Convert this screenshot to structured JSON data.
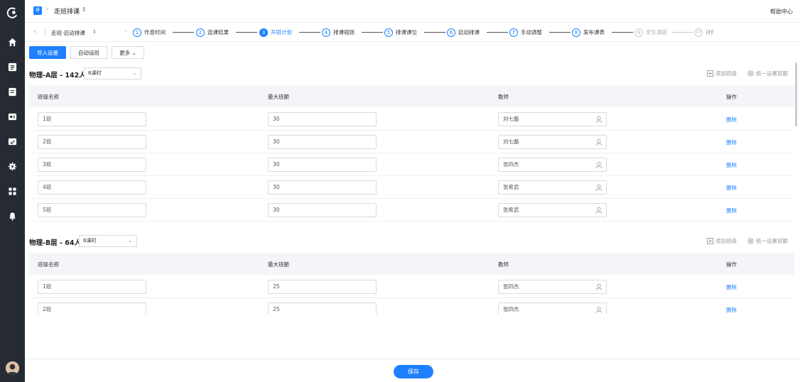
{
  "topbar": {
    "app_badge": "排",
    "title": "走班排课",
    "title_caret": "⇕",
    "help": "帮助中心"
  },
  "stepsbar": {
    "task_name": "走班-启动排课",
    "task_caret": "⇕",
    "steps": [
      {
        "num": "1",
        "label": "作息时间"
      },
      {
        "num": "2",
        "label": "选课结果"
      },
      {
        "num": "3",
        "label": "开班计划"
      },
      {
        "num": "4",
        "label": "排课规则"
      },
      {
        "num": "5",
        "label": "排课课位"
      },
      {
        "num": "6",
        "label": "启动排课"
      },
      {
        "num": "7",
        "label": "手动调整"
      },
      {
        "num": "8",
        "label": "发布课表"
      },
      {
        "num": "9",
        "label": "学生调班"
      },
      {
        "num": "10",
        "label": "排E"
      }
    ],
    "active_step": 3
  },
  "toolbar": {
    "import": "导入设置",
    "auto": "自动设班",
    "more": "更多 ⌄"
  },
  "sections": [
    {
      "title": "物理-A层 - 142人",
      "hours": "6课时",
      "add_class": "添加班级",
      "unify": "统一设置班额",
      "headers": {
        "name": "班级名称",
        "cap": "最大班额",
        "teacher": "教师",
        "op": "操作"
      },
      "rows": [
        {
          "name": "1班",
          "cap": "30",
          "teacher": "刘七磊",
          "op": "删除"
        },
        {
          "name": "2班",
          "cap": "30",
          "teacher": "刘七磊",
          "op": "删除"
        },
        {
          "name": "3班",
          "cap": "30",
          "teacher": "张四杰",
          "op": "删除"
        },
        {
          "name": "4班",
          "cap": "30",
          "teacher": "张希武",
          "op": "删除"
        },
        {
          "name": "5班",
          "cap": "30",
          "teacher": "张希武",
          "op": "删除"
        }
      ]
    },
    {
      "title": "物理-B层 - 64人",
      "hours": "6课时",
      "add_class": "添加班级",
      "unify": "统一设置班额",
      "headers": {
        "name": "班级名称",
        "cap": "最大班额",
        "teacher": "教师",
        "op": "操作"
      },
      "rows": [
        {
          "name": "1班",
          "cap": "25",
          "teacher": "张四杰",
          "op": "删除"
        },
        {
          "name": "2班",
          "cap": "25",
          "teacher": "张四杰",
          "op": "删除"
        }
      ]
    }
  ],
  "footer": {
    "save": "保存"
  },
  "colors": {
    "accent": "#1e80ff",
    "rail": "#262b33"
  }
}
